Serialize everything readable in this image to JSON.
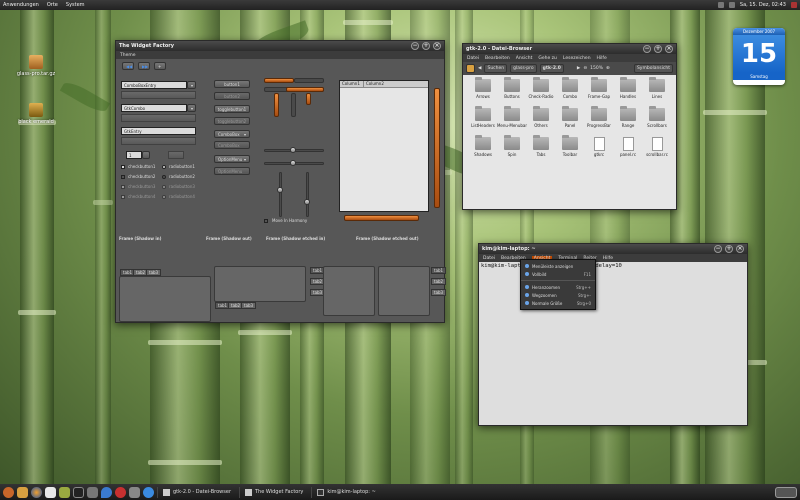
{
  "top_panel": {
    "menus": [
      "Anwendungen",
      "Orte",
      "System"
    ],
    "clock": "Sa, 15. Dez, 02:43"
  },
  "desktop_icons": [
    {
      "label": "glass-pro.tar.gz"
    },
    {
      "label": "black emerald"
    }
  ],
  "calendar": {
    "month": "Dezember 2007",
    "day": "15",
    "weekday": "Samstag"
  },
  "widget_factory": {
    "title": "The Widget Factory",
    "menu": "Theme",
    "entries": {
      "combo_entry": "ComboBoxEntry",
      "gtk_combo": "GtkCombo",
      "gtk_entry": "GtkEntry",
      "spin1": "1"
    },
    "buttons": {
      "b1": "button1",
      "b2": "button2",
      "t1": "togglebutton1",
      "t2": "togglebutton2",
      "combo": "ComboBox",
      "combo2": "ComboBox",
      "opt": "OptionMenu",
      "opt2": "OptionMenu"
    },
    "checks": [
      "checkbutton1",
      "checkbutton2",
      "checkbutton3",
      "checkbutton4"
    ],
    "radios": [
      "radiobutton1",
      "radiobutton2",
      "radiobutton3",
      "radiobutton4"
    ],
    "tree_cols": [
      "Column1",
      "Column2"
    ],
    "move_label": "Move In Harmony",
    "frames": [
      "Frame (Shadow in)",
      "Frame (Shadow out)",
      "Frame (Shadow etched in)",
      "Frame (Shadow etched out)"
    ],
    "tabs": [
      "tab1",
      "tab2",
      "tab3"
    ]
  },
  "file_browser": {
    "title": "gtk-2.0 - Datei-Browser",
    "menu": [
      "Datei",
      "Bearbeiten",
      "Ansicht",
      "Gehe zu",
      "Lesezeichen",
      "Hilfe"
    ],
    "toolbar": {
      "path": [
        "Suchen",
        "glass-pro",
        "gtk-2.0"
      ],
      "zoom": "150%",
      "view": "Symbolansicht"
    },
    "items": [
      {
        "name": "Arrows",
        "type": "folder"
      },
      {
        "name": "Buttons",
        "type": "folder"
      },
      {
        "name": "Check-Radio",
        "type": "folder"
      },
      {
        "name": "Combo",
        "type": "folder"
      },
      {
        "name": "Frame-Gap",
        "type": "folder"
      },
      {
        "name": "Handles",
        "type": "folder"
      },
      {
        "name": "Lines",
        "type": "folder"
      },
      {
        "name": "ListHeaders",
        "type": "folder"
      },
      {
        "name": "Menu-Menubar",
        "type": "folder"
      },
      {
        "name": "Others",
        "type": "folder"
      },
      {
        "name": "Panel",
        "type": "folder"
      },
      {
        "name": "ProgressBar",
        "type": "folder"
      },
      {
        "name": "Range",
        "type": "folder"
      },
      {
        "name": "Scrollbars",
        "type": "folder"
      },
      {
        "name": "Shadows",
        "type": "folder"
      },
      {
        "name": "Spin",
        "type": "folder"
      },
      {
        "name": "Tabs",
        "type": "folder"
      },
      {
        "name": "Toolbar",
        "type": "folder"
      },
      {
        "name": "gtkrc",
        "type": "doc"
      },
      {
        "name": "panel.rc",
        "type": "doc"
      },
      {
        "name": "scrollbar.rc",
        "type": "doc"
      }
    ]
  },
  "terminal": {
    "title": "kim@kim-laptop: ~",
    "menu": [
      "Datei",
      "Bearbeiten",
      "Ansicht",
      "Terminal",
      "Reiter",
      "Hilfe"
    ],
    "prompt": "kim@kim-lapto",
    "prompt_tail": "-delay=10",
    "dropdown": [
      {
        "label": "Menüleiste anzeigen",
        "shortcut": ""
      },
      {
        "label": "Vollbild",
        "shortcut": "F11"
      },
      {
        "label": "Heranzoomen",
        "shortcut": "Strg++"
      },
      {
        "label": "Wegzoomen",
        "shortcut": "Strg+-"
      },
      {
        "label": "Normale Größe",
        "shortcut": "Strg+0"
      }
    ]
  },
  "taskbar": [
    {
      "label": "gtk-2.0 - Datei-Browser"
    },
    {
      "label": "The Widget Factory"
    },
    {
      "label": "kim@kim-laptop: ~"
    }
  ]
}
